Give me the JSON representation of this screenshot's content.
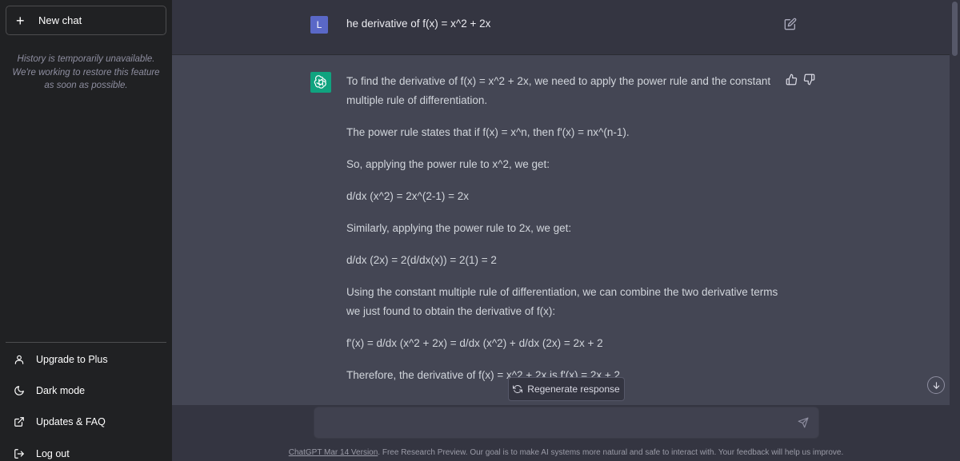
{
  "sidebar": {
    "new_chat_label": "New chat",
    "history_note": "History is temporarily unavailable. We're working to restore this feature as soon as possible.",
    "items": [
      {
        "label": "Upgrade to Plus",
        "icon": "user-icon"
      },
      {
        "label": "Dark mode",
        "icon": "moon-icon"
      },
      {
        "label": "Updates & FAQ",
        "icon": "external-link-icon"
      },
      {
        "label": "Log out",
        "icon": "logout-icon"
      }
    ]
  },
  "conversation": {
    "user_initial": "L",
    "user_message": "he derivative of f(x) = x^2 + 2x",
    "assistant_paragraphs": [
      "To find the derivative of f(x) = x^2 + 2x, we need to apply the power rule and the constant multiple rule of differentiation.",
      "The power rule states that if f(x) = x^n, then f'(x) = nx^(n-1).",
      "So, applying the power rule to x^2, we get:",
      "d/dx (x^2) = 2x^(2-1) = 2x",
      "Similarly, applying the power rule to 2x, we get:",
      "d/dx (2x) = 2(d/dx(x)) = 2(1) = 2",
      "Using the constant multiple rule of differentiation, we can combine the two derivative terms we just found to obtain the derivative of f(x):",
      "f'(x) = d/dx (x^2 + 2x) = d/dx (x^2) + d/dx (2x) = 2x + 2",
      "Therefore, the derivative of f(x) = x^2 + 2x is f'(x) = 2x + 2."
    ]
  },
  "composer": {
    "regenerate_label": "Regenerate response",
    "input_value": "",
    "placeholder": ""
  },
  "footer": {
    "version_link": "ChatGPT Mar 14 Version",
    "text": ". Free Research Preview. Our goal is to make AI systems more natural and safe to interact with. Your feedback will help us improve."
  },
  "colors": {
    "sidebar_bg": "#202123",
    "main_bg": "#343541",
    "assistant_bg": "#444654",
    "gpt_green": "#10a37f",
    "user_avatar": "#5a68c7"
  }
}
